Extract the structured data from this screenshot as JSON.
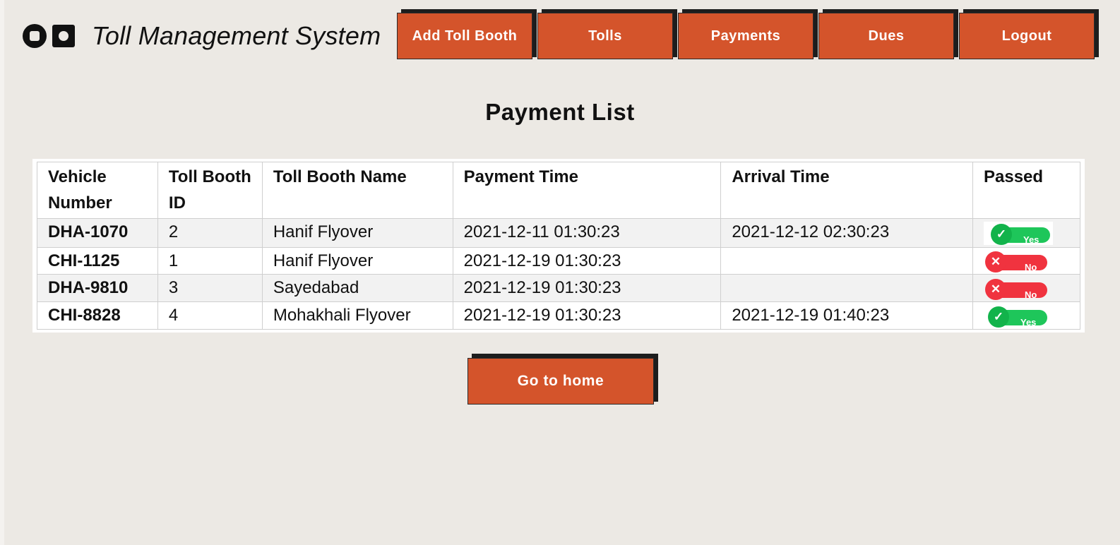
{
  "app": {
    "title": "Toll Management System"
  },
  "nav": {
    "items": [
      {
        "label": "Add Toll Booth"
      },
      {
        "label": "Tolls"
      },
      {
        "label": "Payments"
      },
      {
        "label": "Dues"
      },
      {
        "label": "Logout"
      }
    ]
  },
  "page": {
    "title": "Payment List"
  },
  "table": {
    "columns": [
      "Vehicle Number",
      "Toll Booth ID",
      "Toll Booth Name",
      "Payment Time",
      "Arrival Time",
      "Passed"
    ],
    "rows": [
      {
        "vehicle": "DHA-1070",
        "booth_id": "2",
        "booth_name": "Hanif Flyover",
        "payment_time": "2021-12-11 01:30:23",
        "arrival_time": "2021-12-12 02:30:23",
        "passed": "Yes"
      },
      {
        "vehicle": "CHI-1125",
        "booth_id": "1",
        "booth_name": "Hanif Flyover",
        "payment_time": "2021-12-19 01:30:23",
        "arrival_time": "",
        "passed": "No"
      },
      {
        "vehicle": "DHA-9810",
        "booth_id": "3",
        "booth_name": "Sayedabad",
        "payment_time": "2021-12-19 01:30:23",
        "arrival_time": "",
        "passed": "No"
      },
      {
        "vehicle": "CHI-8828",
        "booth_id": "4",
        "booth_name": "Mohakhali Flyover",
        "payment_time": "2021-12-19 01:30:23",
        "arrival_time": "2021-12-19 01:40:23",
        "passed": "Yes"
      }
    ]
  },
  "footer": {
    "home_label": "Go to home"
  },
  "colors": {
    "background": "#ece9e4",
    "button": "#d4542b",
    "button_shadow": "#1d1d1d",
    "yes": "#1ec65a",
    "no": "#f0333f"
  },
  "icons": {
    "logo": [
      "circle-square-logo-icon",
      "square-circle-logo-icon"
    ],
    "yes": "checkmark-icon",
    "no": "x-mark-icon"
  }
}
